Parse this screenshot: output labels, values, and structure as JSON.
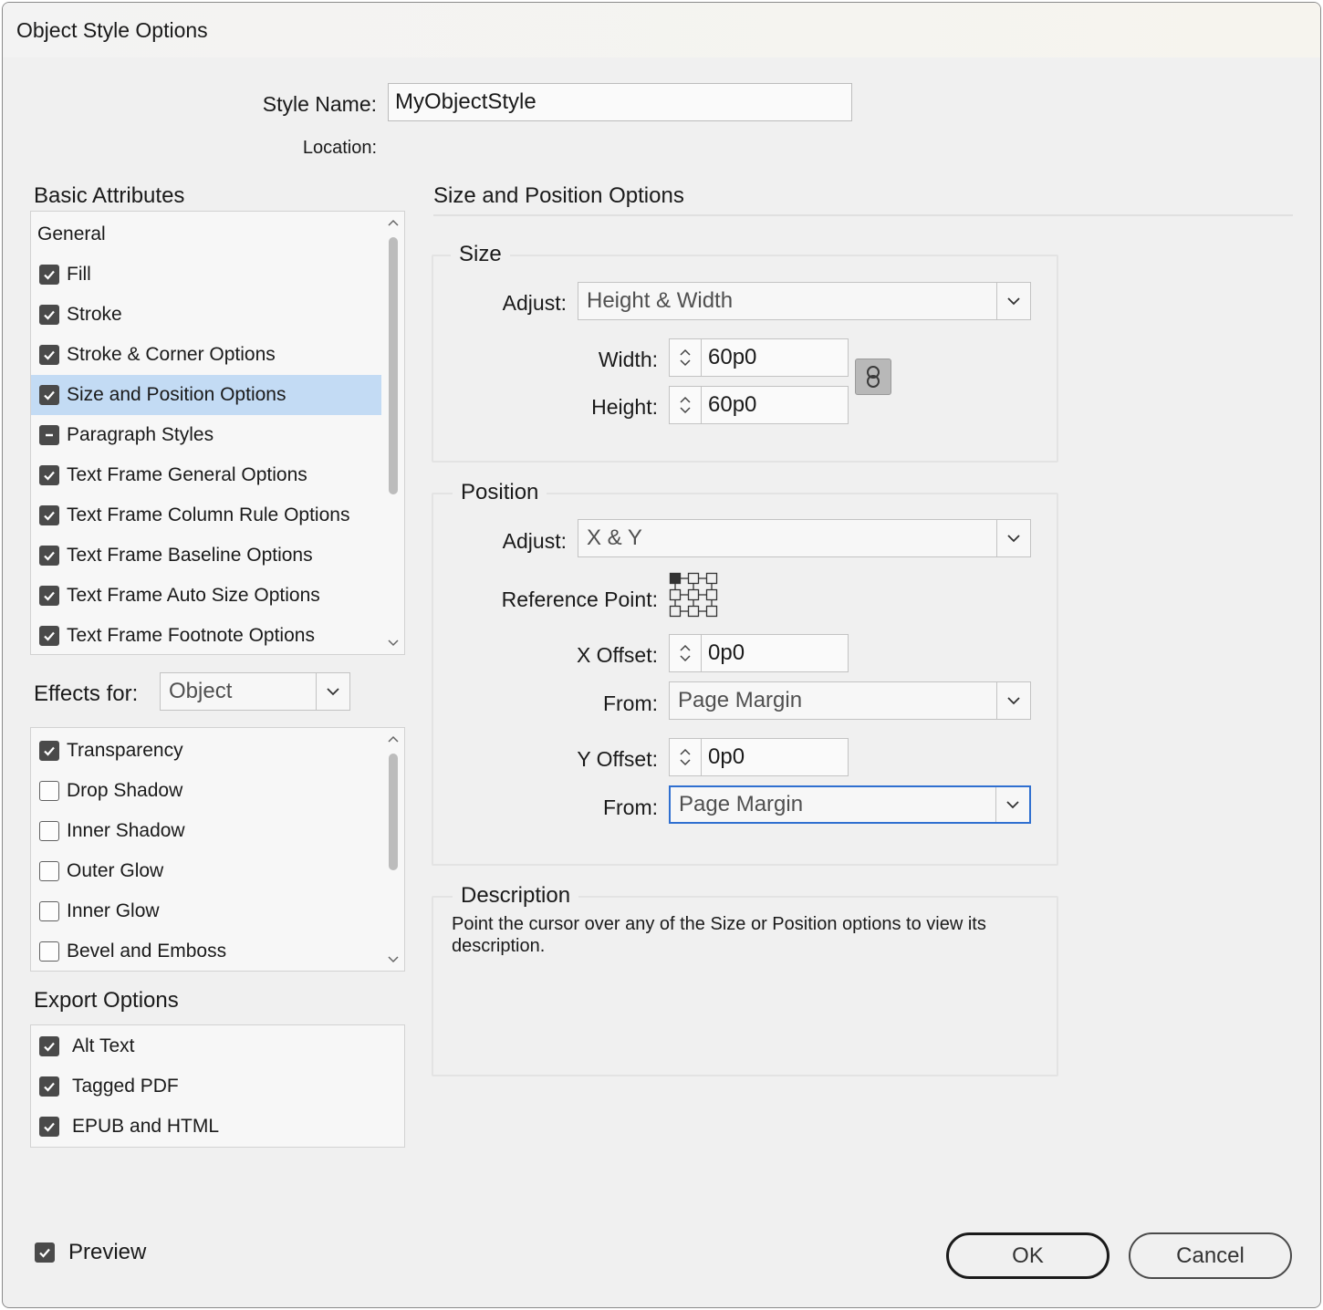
{
  "window": {
    "title": "Object Style Options"
  },
  "style_name": {
    "label": "Style Name:",
    "value": "MyObjectStyle"
  },
  "location": {
    "label": "Location:"
  },
  "basic_attributes": {
    "heading": "Basic Attributes",
    "items": [
      {
        "label": "General",
        "state": "none"
      },
      {
        "label": "Fill",
        "state": "checked"
      },
      {
        "label": "Stroke",
        "state": "checked"
      },
      {
        "label": "Stroke & Corner Options",
        "state": "checked"
      },
      {
        "label": "Size and Position Options",
        "state": "checked",
        "selected": true
      },
      {
        "label": "Paragraph Styles",
        "state": "mixed"
      },
      {
        "label": "Text Frame General Options",
        "state": "checked"
      },
      {
        "label": "Text Frame Column Rule Options",
        "state": "checked"
      },
      {
        "label": "Text Frame Baseline Options",
        "state": "checked"
      },
      {
        "label": "Text Frame Auto Size Options",
        "state": "checked"
      },
      {
        "label": "Text Frame Footnote Options",
        "state": "checked"
      }
    ]
  },
  "effects": {
    "label": "Effects for:",
    "target": "Object",
    "items": [
      {
        "label": "Transparency",
        "state": "checked"
      },
      {
        "label": "Drop Shadow",
        "state": "unchecked"
      },
      {
        "label": "Inner Shadow",
        "state": "unchecked"
      },
      {
        "label": "Outer Glow",
        "state": "unchecked"
      },
      {
        "label": "Inner Glow",
        "state": "unchecked"
      },
      {
        "label": "Bevel and Emboss",
        "state": "unchecked"
      }
    ]
  },
  "export_options": {
    "heading": "Export Options",
    "items": [
      {
        "label": "Alt Text",
        "state": "checked"
      },
      {
        "label": "Tagged PDF",
        "state": "checked"
      },
      {
        "label": "EPUB and HTML",
        "state": "checked"
      }
    ]
  },
  "panel": {
    "heading": "Size and Position Options"
  },
  "size": {
    "heading": "Size",
    "adjust_label": "Adjust:",
    "adjust_value": "Height & Width",
    "width_label": "Width:",
    "width_value": "60p0",
    "height_label": "Height:",
    "height_value": "60p0",
    "link_icon": "chain-link-icon"
  },
  "position": {
    "heading": "Position",
    "adjust_label": "Adjust:",
    "adjust_value": "X & Y",
    "reference_point_label": "Reference Point:",
    "reference_point_selected": "top-left",
    "x_offset_label": "X Offset:",
    "x_offset_value": "0p0",
    "x_from_label": "From:",
    "x_from_value": "Page Margin",
    "y_offset_label": "Y Offset:",
    "y_offset_value": "0p0",
    "y_from_label": "From:",
    "y_from_value": "Page Margin"
  },
  "description": {
    "heading": "Description",
    "text": "Point the cursor over any of the Size or Position options to view its description."
  },
  "preview": {
    "label": "Preview",
    "state": "checked"
  },
  "buttons": {
    "ok": "OK",
    "cancel": "Cancel"
  },
  "colors": {
    "selection": "#c3dbf4",
    "focus": "#2f6fd0",
    "dialog_bg": "#f0f0f0"
  }
}
